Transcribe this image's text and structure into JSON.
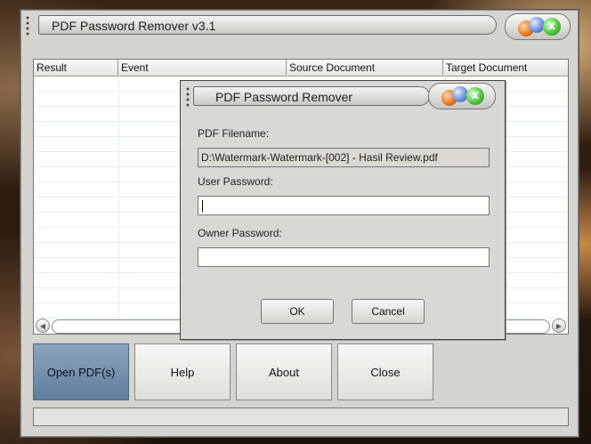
{
  "app": {
    "title": "PDF Password Remover v3.1",
    "colors": {
      "active_button": "#6e8caa",
      "window_bg": "#d6d4cf"
    }
  },
  "list": {
    "columns": [
      "Result",
      "Event",
      "Source Document",
      "Target Document"
    ]
  },
  "buttons": {
    "open_pdfs": "Open PDF(s)",
    "help": "Help",
    "about": "About",
    "close": "Close"
  },
  "dialog": {
    "title": "PDF Password Remover",
    "filename_label": "PDF Filename:",
    "filename_value": "D:\\Watermark-Watermark-[002] - Hasil Review.pdf",
    "user_password_label": "User Password:",
    "user_password_value": "",
    "owner_password_label": "Owner Password:",
    "owner_password_value": "",
    "ok_label": "OK",
    "cancel_label": "Cancel",
    "close_glyph": "x"
  },
  "icons": {
    "scroll_left": "◀",
    "scroll_right": "▶"
  }
}
